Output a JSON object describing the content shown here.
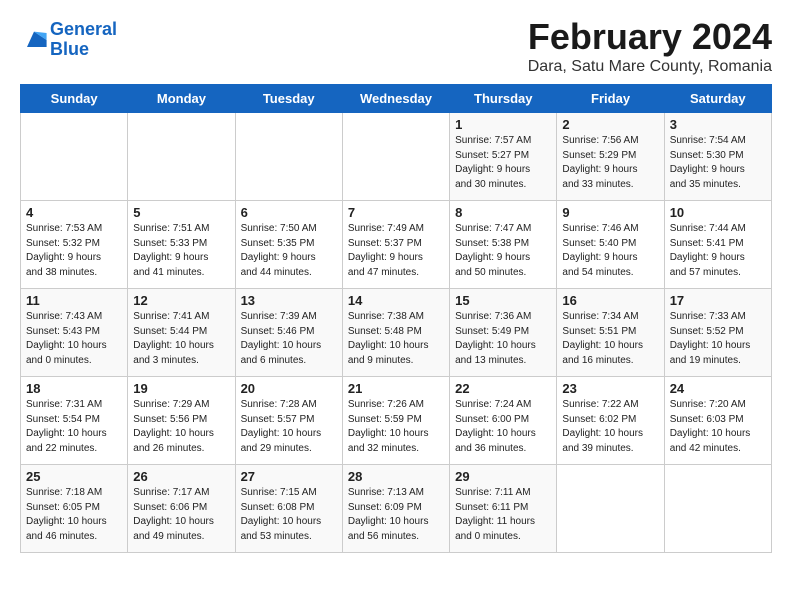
{
  "header": {
    "logo_line1": "General",
    "logo_line2": "Blue",
    "month_title": "February 2024",
    "location": "Dara, Satu Mare County, Romania"
  },
  "days_of_week": [
    "Sunday",
    "Monday",
    "Tuesday",
    "Wednesday",
    "Thursday",
    "Friday",
    "Saturday"
  ],
  "weeks": [
    [
      {
        "day": "",
        "info": ""
      },
      {
        "day": "",
        "info": ""
      },
      {
        "day": "",
        "info": ""
      },
      {
        "day": "",
        "info": ""
      },
      {
        "day": "1",
        "info": "Sunrise: 7:57 AM\nSunset: 5:27 PM\nDaylight: 9 hours\nand 30 minutes."
      },
      {
        "day": "2",
        "info": "Sunrise: 7:56 AM\nSunset: 5:29 PM\nDaylight: 9 hours\nand 33 minutes."
      },
      {
        "day": "3",
        "info": "Sunrise: 7:54 AM\nSunset: 5:30 PM\nDaylight: 9 hours\nand 35 minutes."
      }
    ],
    [
      {
        "day": "4",
        "info": "Sunrise: 7:53 AM\nSunset: 5:32 PM\nDaylight: 9 hours\nand 38 minutes."
      },
      {
        "day": "5",
        "info": "Sunrise: 7:51 AM\nSunset: 5:33 PM\nDaylight: 9 hours\nand 41 minutes."
      },
      {
        "day": "6",
        "info": "Sunrise: 7:50 AM\nSunset: 5:35 PM\nDaylight: 9 hours\nand 44 minutes."
      },
      {
        "day": "7",
        "info": "Sunrise: 7:49 AM\nSunset: 5:37 PM\nDaylight: 9 hours\nand 47 minutes."
      },
      {
        "day": "8",
        "info": "Sunrise: 7:47 AM\nSunset: 5:38 PM\nDaylight: 9 hours\nand 50 minutes."
      },
      {
        "day": "9",
        "info": "Sunrise: 7:46 AM\nSunset: 5:40 PM\nDaylight: 9 hours\nand 54 minutes."
      },
      {
        "day": "10",
        "info": "Sunrise: 7:44 AM\nSunset: 5:41 PM\nDaylight: 9 hours\nand 57 minutes."
      }
    ],
    [
      {
        "day": "11",
        "info": "Sunrise: 7:43 AM\nSunset: 5:43 PM\nDaylight: 10 hours\nand 0 minutes."
      },
      {
        "day": "12",
        "info": "Sunrise: 7:41 AM\nSunset: 5:44 PM\nDaylight: 10 hours\nand 3 minutes."
      },
      {
        "day": "13",
        "info": "Sunrise: 7:39 AM\nSunset: 5:46 PM\nDaylight: 10 hours\nand 6 minutes."
      },
      {
        "day": "14",
        "info": "Sunrise: 7:38 AM\nSunset: 5:48 PM\nDaylight: 10 hours\nand 9 minutes."
      },
      {
        "day": "15",
        "info": "Sunrise: 7:36 AM\nSunset: 5:49 PM\nDaylight: 10 hours\nand 13 minutes."
      },
      {
        "day": "16",
        "info": "Sunrise: 7:34 AM\nSunset: 5:51 PM\nDaylight: 10 hours\nand 16 minutes."
      },
      {
        "day": "17",
        "info": "Sunrise: 7:33 AM\nSunset: 5:52 PM\nDaylight: 10 hours\nand 19 minutes."
      }
    ],
    [
      {
        "day": "18",
        "info": "Sunrise: 7:31 AM\nSunset: 5:54 PM\nDaylight: 10 hours\nand 22 minutes."
      },
      {
        "day": "19",
        "info": "Sunrise: 7:29 AM\nSunset: 5:56 PM\nDaylight: 10 hours\nand 26 minutes."
      },
      {
        "day": "20",
        "info": "Sunrise: 7:28 AM\nSunset: 5:57 PM\nDaylight: 10 hours\nand 29 minutes."
      },
      {
        "day": "21",
        "info": "Sunrise: 7:26 AM\nSunset: 5:59 PM\nDaylight: 10 hours\nand 32 minutes."
      },
      {
        "day": "22",
        "info": "Sunrise: 7:24 AM\nSunset: 6:00 PM\nDaylight: 10 hours\nand 36 minutes."
      },
      {
        "day": "23",
        "info": "Sunrise: 7:22 AM\nSunset: 6:02 PM\nDaylight: 10 hours\nand 39 minutes."
      },
      {
        "day": "24",
        "info": "Sunrise: 7:20 AM\nSunset: 6:03 PM\nDaylight: 10 hours\nand 42 minutes."
      }
    ],
    [
      {
        "day": "25",
        "info": "Sunrise: 7:18 AM\nSunset: 6:05 PM\nDaylight: 10 hours\nand 46 minutes."
      },
      {
        "day": "26",
        "info": "Sunrise: 7:17 AM\nSunset: 6:06 PM\nDaylight: 10 hours\nand 49 minutes."
      },
      {
        "day": "27",
        "info": "Sunrise: 7:15 AM\nSunset: 6:08 PM\nDaylight: 10 hours\nand 53 minutes."
      },
      {
        "day": "28",
        "info": "Sunrise: 7:13 AM\nSunset: 6:09 PM\nDaylight: 10 hours\nand 56 minutes."
      },
      {
        "day": "29",
        "info": "Sunrise: 7:11 AM\nSunset: 6:11 PM\nDaylight: 11 hours\nand 0 minutes."
      },
      {
        "day": "",
        "info": ""
      },
      {
        "day": "",
        "info": ""
      }
    ]
  ]
}
